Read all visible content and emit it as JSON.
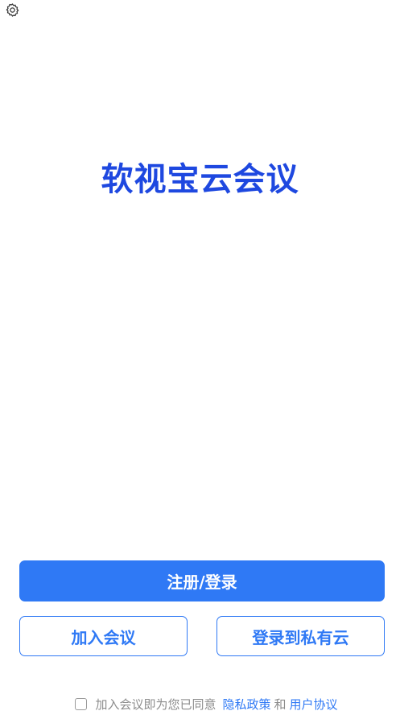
{
  "header": {
    "settings_icon": "gear-icon"
  },
  "title": "软视宝云会议",
  "buttons": {
    "register_login": "注册/登录",
    "join_meeting": "加入会议",
    "private_cloud_login": "登录到私有云"
  },
  "agreement": {
    "prefix": "加入会议即为您已同意",
    "privacy_policy": "隐私政策",
    "and": "和",
    "user_agreement": "用户协议"
  },
  "colors": {
    "title": "#1e48e0",
    "primary": "#2f79f5",
    "muted_text": "#8c8c8c"
  }
}
